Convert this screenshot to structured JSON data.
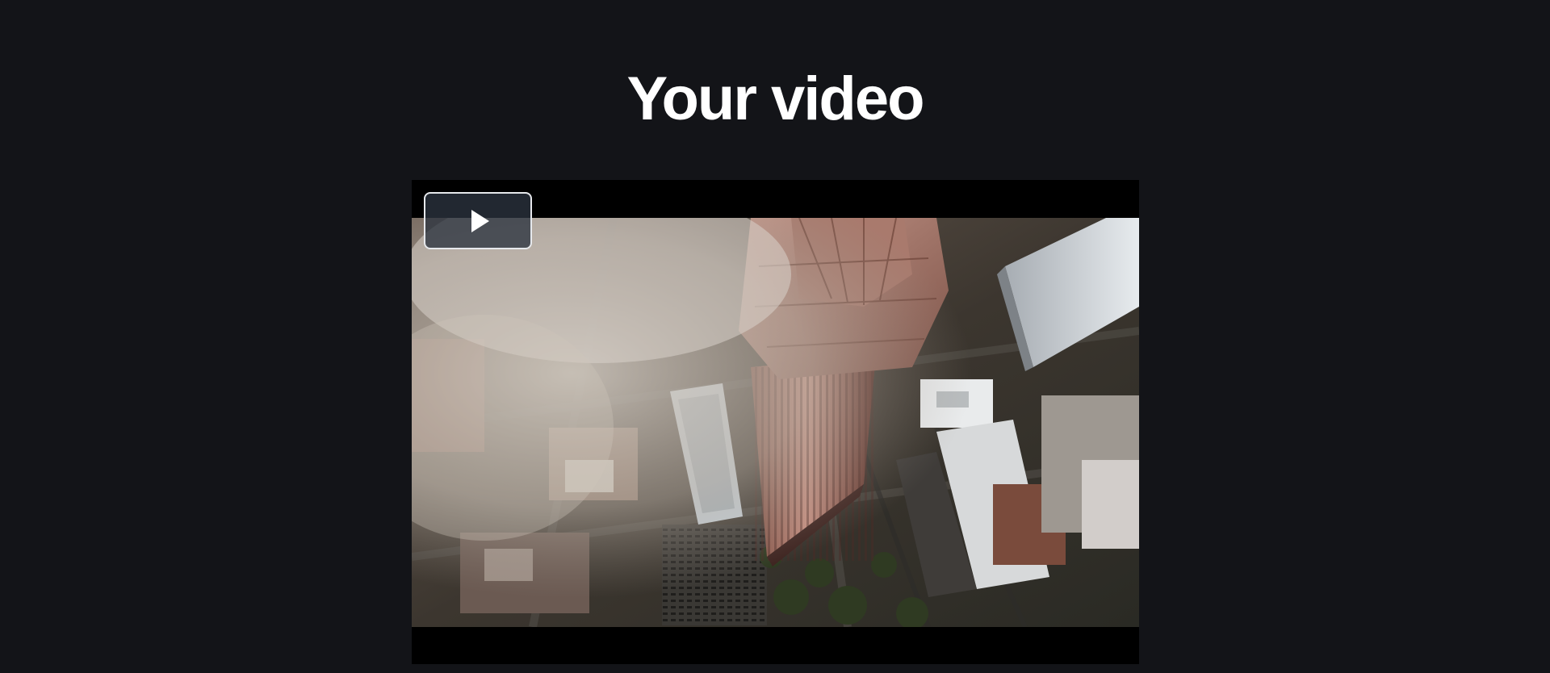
{
  "page": {
    "title": "Your video"
  },
  "player": {
    "play_icon": "play-icon",
    "state": "paused"
  },
  "colors": {
    "background": "#131418",
    "title": "#ffffff",
    "player_background": "#000000",
    "play_button_fill": "#2b333f",
    "play_button_border": "#e6e8ec"
  }
}
